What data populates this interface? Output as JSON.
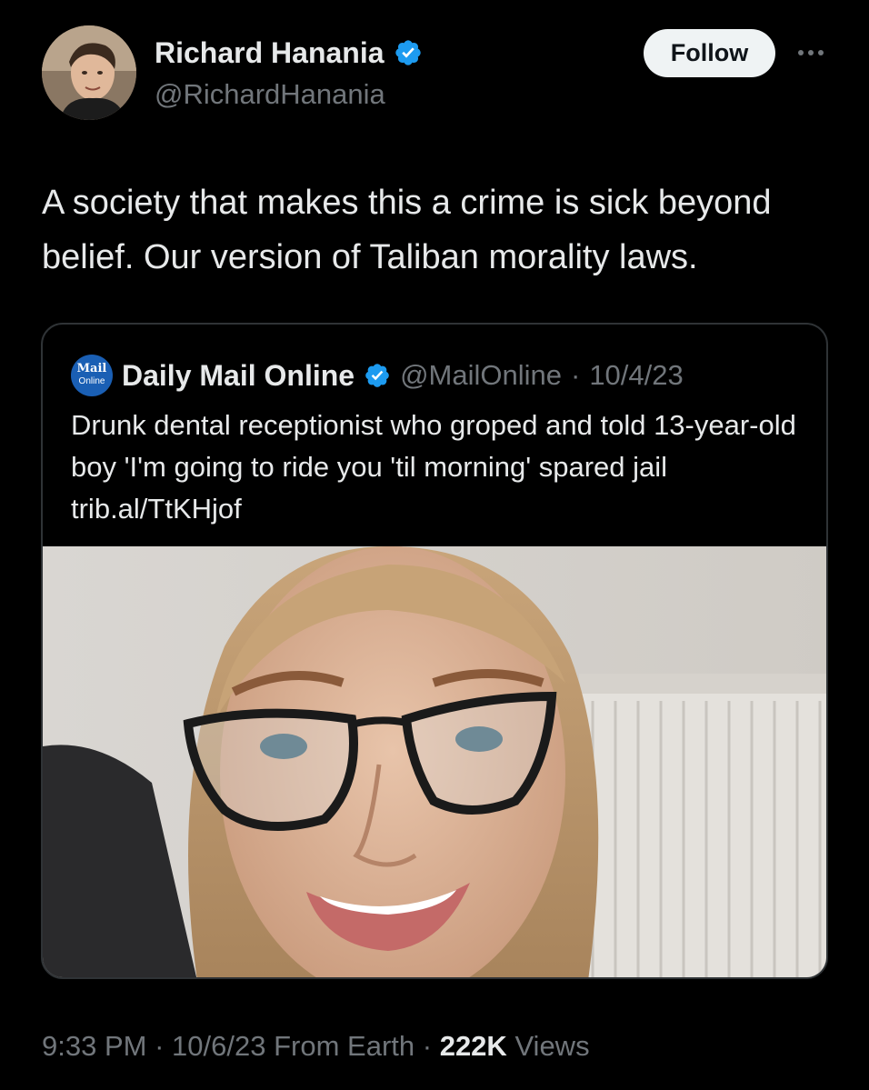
{
  "author": {
    "display_name": "Richard Hanania",
    "handle": "@RichardHanania",
    "avatar_icon": "avatar-photo"
  },
  "actions": {
    "follow_label": "Follow",
    "more_icon": "more-icon"
  },
  "tweet": {
    "text": "A society that makes this a crime is sick beyond belief. Our version of Taliban morality laws."
  },
  "quote": {
    "logo": {
      "line1": "Mail",
      "line2": "Online"
    },
    "display_name": "Daily Mail Online",
    "handle": "@MailOnline",
    "separator": "·",
    "date": "10/4/23",
    "text": "Drunk dental receptionist who groped and told 13-year-old boy 'I'm going to ride you 'til morning' spared jail trib.al/TtKHjof"
  },
  "footer": {
    "time": "9:33 PM",
    "sep1": "·",
    "date": "10/6/23",
    "source": "From Earth",
    "sep2": "·",
    "views_count": "222K",
    "views_label": "Views"
  },
  "colors": {
    "background": "#000000",
    "text_primary": "#e7e9ea",
    "text_secondary": "#71767b",
    "verified_blue": "#1d9bf0",
    "border": "#2f3336",
    "follow_bg": "#eff3f4"
  }
}
